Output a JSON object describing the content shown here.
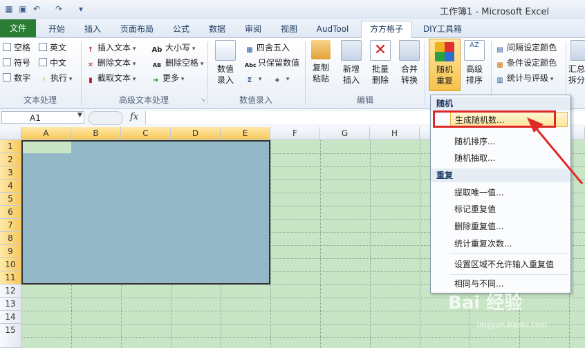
{
  "window": {
    "title": "工作簿1 - Microsoft Excel"
  },
  "tabs": [
    "文件",
    "开始",
    "插入",
    "页面布局",
    "公式",
    "数据",
    "审阅",
    "视图",
    "AudTool",
    "方方格子",
    "DIY工具箱"
  ],
  "active_tab": "方方格子",
  "ribbon": {
    "text_processing": {
      "label": "文本处理",
      "checks": [
        "空格",
        "英文",
        "符号",
        "中文",
        "数字"
      ],
      "run": "执行"
    },
    "advanced_text": {
      "label": "高级文本处理",
      "insert_text": "插入文本",
      "delete_text": "删除文本",
      "extract_text": "截取文本",
      "case": "大小写",
      "delete_spaces": "删除空格",
      "more": "更多"
    },
    "value_entry": {
      "label": "数值录入",
      "big_button": "数值\n录入",
      "round": "四舍五入",
      "keep_values": "只保留数值"
    },
    "edit": {
      "label": "编辑",
      "copy_paste": "复制\n粘贴",
      "add_insert": "新增\n插入",
      "batch_delete": "批量\n删除",
      "merge_convert": "合并\n转换"
    },
    "random_repeat": "随机\n重复",
    "advanced_sort": "高级\n排序",
    "interval_color": "间隔设定颜色",
    "cond_color": "条件设定颜色",
    "stats_rating": "统计与评级",
    "summary_split": "汇总\n拆分"
  },
  "formula_bar": {
    "name_box": "A1",
    "fx": "fx"
  },
  "columns": [
    "A",
    "B",
    "C",
    "D",
    "E",
    "F",
    "G",
    "H"
  ],
  "rows": [
    "1",
    "2",
    "3",
    "4",
    "5",
    "6",
    "7",
    "8",
    "9",
    "10",
    "11",
    "12",
    "13",
    "14",
    "15"
  ],
  "menu": {
    "section_random": "随机",
    "items_random": [
      "生成随机数...",
      "随机排序...",
      "随机抽取..."
    ],
    "section_repeat": "重复",
    "items_repeat": [
      "提取唯一值...",
      "标记重复值",
      "删除重复值...",
      "统计重复次数...",
      "设置区域不允许输入重复值",
      "相同与不同..."
    ]
  },
  "watermark": {
    "brand": "Bai 经验",
    "url": "jingyan.baidu.com"
  },
  "colors": {
    "file_tab": "#2a7d33",
    "selection": "#93b9c9",
    "grid_bg": "#c8e6c6",
    "highlight_box": "#e02828",
    "arrow": "#e02828"
  }
}
